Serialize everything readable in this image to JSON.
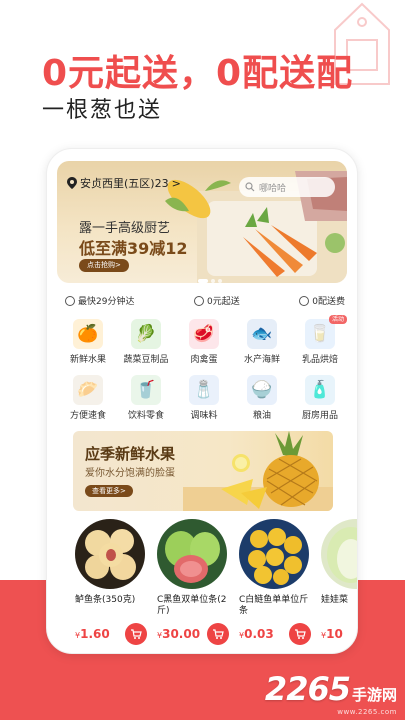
{
  "promo": {
    "title": "0元起送，0配送配",
    "subtitle": "一根葱也送"
  },
  "header": {
    "location": "安贞西里(五区)23",
    "location_chevron": ">",
    "search_placeholder": "哪哈哈"
  },
  "banner": {
    "line1": "露一手高级厨艺",
    "line2": "低至满39减12",
    "button": "点击抢购>"
  },
  "services": [
    {
      "icon": "clock-icon",
      "label": "最快29分钟达"
    },
    {
      "icon": "coin-icon",
      "label": "0元起送"
    },
    {
      "icon": "truck-icon",
      "label": "0配送费"
    }
  ],
  "categories": [
    {
      "name": "fresh-fruit",
      "label": "新鲜水果",
      "glyph": "🍊",
      "color": "#fff1d6"
    },
    {
      "name": "vegetables",
      "label": "蔬菜豆制品",
      "glyph": "🥬",
      "color": "#e5f5e2"
    },
    {
      "name": "meat-eggs",
      "label": "肉禽蛋",
      "glyph": "🥩",
      "color": "#fde6ea"
    },
    {
      "name": "seafood",
      "label": "水产海鲜",
      "glyph": "🐟",
      "color": "#e6eef8"
    },
    {
      "name": "dairy",
      "label": "乳品烘焙",
      "glyph": "🥛",
      "color": "#e8f2fd",
      "badge": "活动"
    },
    {
      "name": "instant-food",
      "label": "方便速食",
      "glyph": "🥟",
      "color": "#f5f1ea"
    },
    {
      "name": "drinks-snacks",
      "label": "饮料零食",
      "glyph": "🥤",
      "color": "#eaf6ea"
    },
    {
      "name": "seasoning",
      "label": "调味料",
      "glyph": "🧂",
      "color": "#eaf1fb"
    },
    {
      "name": "grain-oil",
      "label": "粮油",
      "glyph": "🍚",
      "color": "#e8f0fb"
    },
    {
      "name": "kitchen-goods",
      "label": "厨房用品",
      "glyph": "🧴",
      "color": "#e8f4fb"
    }
  ],
  "fruit_promo": {
    "title": "应季新鲜水果",
    "subtitle": "爱你水分饱满的脸蛋",
    "button": "查看更多>"
  },
  "products": [
    {
      "name": "鲈鱼条(350克)",
      "currency": "¥",
      "price": "1.60"
    },
    {
      "name": "C黑鱼双单位条(2斤)",
      "currency": "¥",
      "price": "30.00"
    },
    {
      "name": "C白鲢鱼单单位斤条",
      "currency": "¥",
      "price": "0.03"
    },
    {
      "name": "娃娃菜",
      "currency": "¥",
      "price": "10"
    }
  ],
  "watermark": {
    "number": "2265",
    "text": "手游网",
    "url": "www.2265.com"
  },
  "colors": {
    "accent": "#ef4e4e",
    "brown": "#7a4a1a",
    "banner_bg": "#f4e4c4"
  }
}
